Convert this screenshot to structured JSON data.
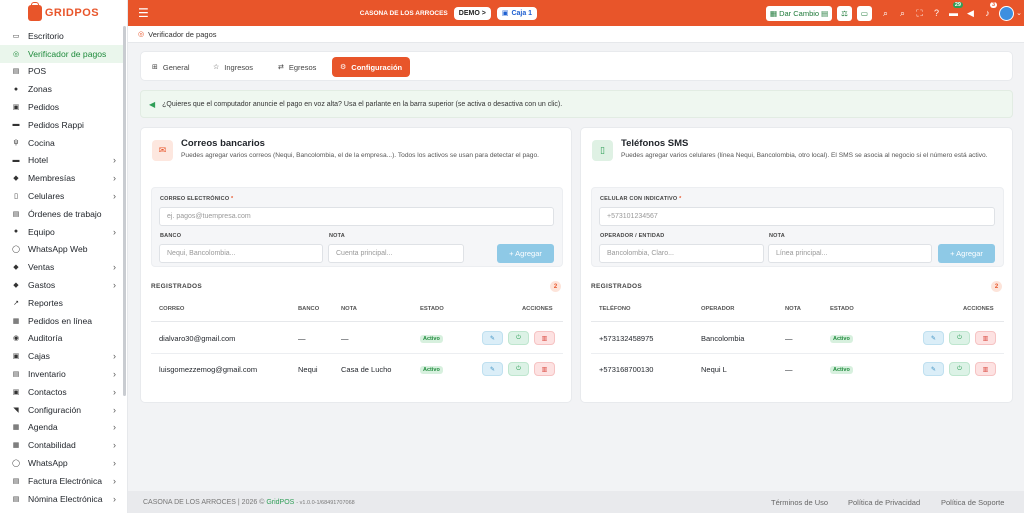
{
  "app": {
    "logo": "GRIDPOS"
  },
  "sidebar": {
    "items": [
      {
        "label": "Escritorio",
        "icon": "desktop-icon",
        "chevron": false
      },
      {
        "label": "Verificador de pagos",
        "icon": "shield-check-icon",
        "chevron": false,
        "active": true
      },
      {
        "label": "POS",
        "icon": "pos-icon",
        "chevron": false
      },
      {
        "label": "Zonas",
        "icon": "map-pin-icon",
        "chevron": false
      },
      {
        "label": "Pedidos",
        "icon": "orders-icon",
        "chevron": false
      },
      {
        "label": "Pedidos Rappi",
        "icon": "rappi-icon",
        "chevron": false
      },
      {
        "label": "Cocina",
        "icon": "utensils-icon",
        "chevron": false
      },
      {
        "label": "Hotel",
        "icon": "bed-icon",
        "chevron": true
      },
      {
        "label": "Membresías",
        "icon": "membership-icon",
        "chevron": true
      },
      {
        "label": "Celulares",
        "icon": "phone-icon",
        "chevron": true
      },
      {
        "label": "Órdenes de trabajo",
        "icon": "clipboard-icon",
        "chevron": false
      },
      {
        "label": "Equipo",
        "icon": "team-icon",
        "chevron": true
      },
      {
        "label": "WhatsApp Web",
        "icon": "whatsapp-icon",
        "chevron": false
      },
      {
        "label": "Ventas",
        "icon": "sales-icon",
        "chevron": true
      },
      {
        "label": "Gastos",
        "icon": "expenses-icon",
        "chevron": true
      },
      {
        "label": "Reportes",
        "icon": "chart-icon",
        "chevron": false
      },
      {
        "label": "Pedidos en línea",
        "icon": "online-orders-icon",
        "chevron": false
      },
      {
        "label": "Auditoría",
        "icon": "audit-icon",
        "chevron": false
      },
      {
        "label": "Cajas",
        "icon": "cash-register-icon",
        "chevron": true
      },
      {
        "label": "Inventario",
        "icon": "inventory-icon",
        "chevron": true
      },
      {
        "label": "Contactos",
        "icon": "contacts-icon",
        "chevron": true
      },
      {
        "label": "Configuración",
        "icon": "wrench-icon",
        "chevron": true
      },
      {
        "label": "Agenda",
        "icon": "calendar-icon",
        "chevron": true
      },
      {
        "label": "Contabilidad",
        "icon": "accounting-icon",
        "chevron": true
      },
      {
        "label": "WhatsApp",
        "icon": "whatsapp-icon",
        "chevron": true
      },
      {
        "label": "Factura Electrónica",
        "icon": "invoice-icon",
        "chevron": true
      },
      {
        "label": "Nómina Electrónica",
        "icon": "payroll-icon",
        "chevron": true
      }
    ]
  },
  "topbar": {
    "store": "CASONA DE LOS ARROCES",
    "demo": "DEMO >",
    "caja": "Caja 1",
    "dar_cambio": "Dar Cambio",
    "badge_green": "29",
    "badge_bell": "3"
  },
  "breadcrumb": {
    "label": "Verificador de pagos"
  },
  "tabs": [
    {
      "label": "General",
      "icon": "grid-icon"
    },
    {
      "label": "Ingresos",
      "icon": "star-icon"
    },
    {
      "label": "Egresos",
      "icon": "egresos-icon"
    },
    {
      "label": "Configuración",
      "icon": "gear-icon",
      "active": true
    }
  ],
  "alert": {
    "text": "¿Quieres que el computador anuncie el pago en voz alta? Usa el parlante en la barra superior (se activa o desactiva con un clic)."
  },
  "emails": {
    "title": "Correos bancarios",
    "desc": "Puedes agregar varios correos (Nequi, Bancolombia, el de la empresa...). Todos los activos se usan para detectar el pago.",
    "label_email": "CORREO ELECTRÓNICO",
    "placeholder_email": "ej. pagos@tuempresa.com",
    "label_bank": "BANCO",
    "placeholder_bank": "Nequi, Bancolombia...",
    "label_note": "NOTA",
    "placeholder_note": "Cuenta principal...",
    "add": "+ Agregar",
    "registered": "REGISTRADOS",
    "count": "2",
    "headers": [
      "CORREO",
      "BANCO",
      "NOTA",
      "ESTADO",
      "ACCIONES"
    ],
    "rows": [
      {
        "email": "dialvaro30@gmail.com",
        "bank": "—",
        "note": "—",
        "status": "Activo"
      },
      {
        "email": "luisgomezzemog@gmail.com",
        "bank": "Nequi",
        "note": "Casa de Lucho",
        "status": "Activo"
      }
    ]
  },
  "sms": {
    "title": "Teléfonos SMS",
    "desc": "Puedes agregar varios celulares (línea Nequi, Bancolombia, otro local). El SMS se asocia al negocio si el número está activo.",
    "label_phone": "CELULAR CON INDICATIVO",
    "placeholder_phone": "+573101234567",
    "label_operator": "OPERADOR / ENTIDAD",
    "placeholder_operator": "Bancolombia, Claro...",
    "label_note": "NOTA",
    "placeholder_note": "Línea principal...",
    "add": "+ Agregar",
    "registered": "REGISTRADOS",
    "count": "2",
    "headers": [
      "TELÉFONO",
      "OPERADOR",
      "NOTA",
      "ESTADO",
      "ACCIONES"
    ],
    "rows": [
      {
        "phone": "+573132458975",
        "operator": "Bancolombia",
        "note": "—",
        "status": "Activo"
      },
      {
        "phone": "+573168700130",
        "operator": "Nequi L",
        "note": "—",
        "status": "Activo"
      }
    ]
  },
  "footer": {
    "store": "CASONA DE LOS ARROCES | 2026 ©",
    "brand": "GridPOS",
    "version": "- v1.0.0-1/684917070​68",
    "links": [
      "Términos de Uso",
      "Política de Privacidad",
      "Política de Soporte"
    ]
  }
}
